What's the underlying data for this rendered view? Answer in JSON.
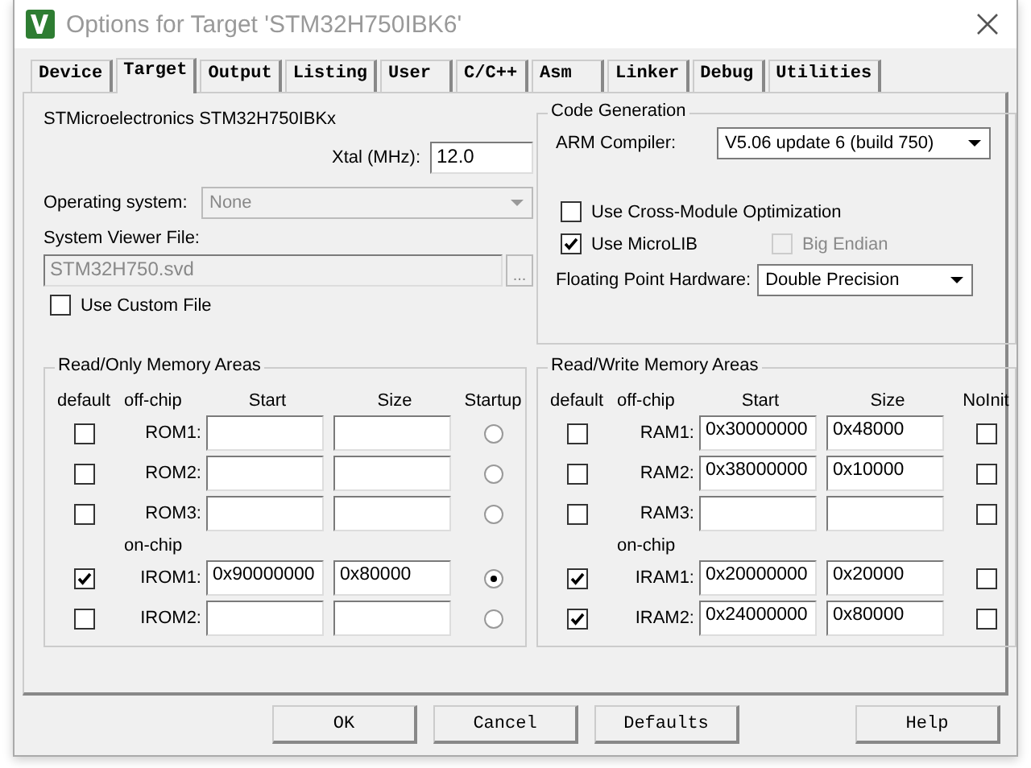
{
  "window": {
    "title": "Options for Target 'STM32H750IBK6'"
  },
  "tabs": [
    {
      "label": "Device",
      "selected": false
    },
    {
      "label": "Target",
      "selected": true
    },
    {
      "label": "Output",
      "selected": false
    },
    {
      "label": "Listing",
      "selected": false
    },
    {
      "label": "User",
      "selected": false
    },
    {
      "label": "C/C++",
      "selected": false
    },
    {
      "label": "Asm",
      "selected": false
    },
    {
      "label": "Linker",
      "selected": false
    },
    {
      "label": "Debug",
      "selected": false
    },
    {
      "label": "Utilities",
      "selected": false
    }
  ],
  "target": {
    "device": "STMicroelectronics STM32H750IBKx",
    "xtal": {
      "label": "Xtal (MHz):",
      "value": "12.0"
    },
    "operating_system": {
      "label": "Operating system:",
      "value": "None",
      "disabled": true
    },
    "system_viewer_file": {
      "label": "System Viewer File:",
      "value": "STM32H750.svd",
      "disabled": true,
      "browse": "..."
    },
    "use_custom_file": {
      "label": "Use Custom File",
      "checked": false
    }
  },
  "code_generation": {
    "title": "Code Generation",
    "arm_compiler": {
      "label": "ARM Compiler:",
      "value": "V5.06 update 6 (build 750)"
    },
    "options": [
      {
        "label": "Use Cross-Module Optimization",
        "checked": false,
        "disabled": false
      },
      {
        "label": "Use MicroLIB",
        "checked": true,
        "disabled": false
      },
      {
        "label": "Big Endian",
        "checked": false,
        "disabled": true
      }
    ],
    "floating_point": {
      "label": "Floating Point Hardware:",
      "value": "Double Precision"
    }
  },
  "memory_areas": [
    {
      "title": "Read/Only Memory Areas",
      "columns": [
        "default",
        "off-chip",
        "Start",
        "Size",
        "Startup"
      ],
      "on_chip_label": "on-chip",
      "off_chip": [
        {
          "name": "ROM1:",
          "default": false,
          "selected": false
        },
        {
          "name": "ROM2:",
          "default": false,
          "selected": false
        },
        {
          "name": "ROM3:",
          "default": false,
          "selected": false
        }
      ],
      "on_chip": [
        {
          "name": "IROM1:",
          "start": "0x90000000",
          "size": "0x80000",
          "default": true,
          "selected": true
        },
        {
          "name": "IROM2:",
          "default": false,
          "selected": false
        }
      ]
    },
    {
      "title": "Read/Write Memory Areas",
      "columns": [
        "default",
        "off-chip",
        "Start",
        "Size",
        "NoInit"
      ],
      "on_chip_label": "on-chip",
      "off_chip": [
        {
          "name": "RAM1:",
          "start": "0x30000000",
          "size": "0x48000",
          "default": false,
          "no_init": false
        },
        {
          "name": "RAM2:",
          "start": "0x38000000",
          "size": "0x10000",
          "default": false,
          "no_init": false
        },
        {
          "name": "RAM3:",
          "default": false,
          "no_init": false
        }
      ],
      "on_chip": [
        {
          "name": "IRAM1:",
          "start": "0x20000000",
          "size": "0x20000",
          "default": true,
          "no_init": false
        },
        {
          "name": "IRAM2:",
          "start": "0x24000000",
          "size": "0x80000",
          "default": true,
          "no_init": false
        }
      ]
    }
  ],
  "buttons": [
    "OK",
    "Cancel",
    "Defaults",
    "Help"
  ]
}
